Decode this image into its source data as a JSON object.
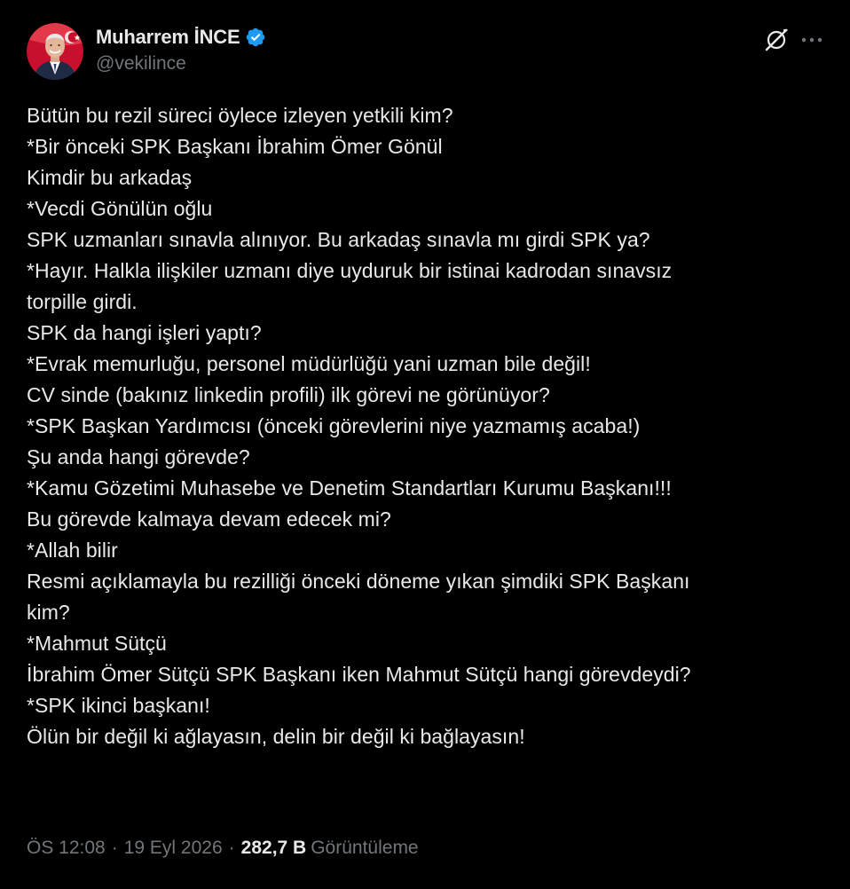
{
  "author": {
    "display_name": "Muharrem İNCE",
    "handle": "@vekilince",
    "verified_color": "#1d9bf0",
    "avatar_icon": "profile-photo"
  },
  "actions": {
    "grok_icon": "grok-icon",
    "more_icon": "more-horizontal-icon"
  },
  "tweet": {
    "lines": [
      "Bütün bu rezil süreci öylece izleyen yetkili kim?",
      "*Bir önceki SPK Başkanı İbrahim Ömer Gönül",
      "Kimdir bu arkadaş",
      "*Vecdi Gönülün oğlu",
      "SPK uzmanları sınavla alınıyor. Bu arkadaş sınavla mı girdi SPK ya?",
      "*Hayır. Halkla ilişkiler uzmanı diye uyduruk bir istinai kadrodan sınavsız",
      "torpille girdi.",
      "SPK da hangi işleri yaptı?",
      "*Evrak memurluğu, personel müdürlüğü yani uzman bile değil!",
      "CV sinde (bakınız linkedin profili) ilk görevi ne görünüyor?",
      "*SPK Başkan Yardımcısı (önceki görevlerini niye yazmamış acaba!)",
      "Şu anda hangi görevde?",
      "*Kamu Gözetimi Muhasebe ve Denetim Standartları Kurumu Başkanı!!!",
      "Bu görevde kalmaya devam edecek mi?",
      "*Allah bilir",
      "Resmi açıklamayla bu rezilliği önceki döneme yıkan şimdiki SPK Başkanı",
      "kim?",
      "*Mahmut Sütçü",
      "İbrahim Ömer Sütçü SPK Başkanı iken Mahmut Sütçü hangi görevdeydi?",
      "*SPK ikinci başkanı!",
      "Ölün bir değil ki ağlayasın, delin bir değil ki bağlayasın!"
    ]
  },
  "meta": {
    "time": "ÖS 12:08",
    "separator": "·",
    "date": "19 Eyl 2026",
    "views_count": "282,7 B",
    "views_label": "Görüntüleme"
  },
  "colors": {
    "background": "#000000",
    "text_primary": "#e7e9ea",
    "text_secondary": "#71767b",
    "accent": "#1d9bf0"
  }
}
